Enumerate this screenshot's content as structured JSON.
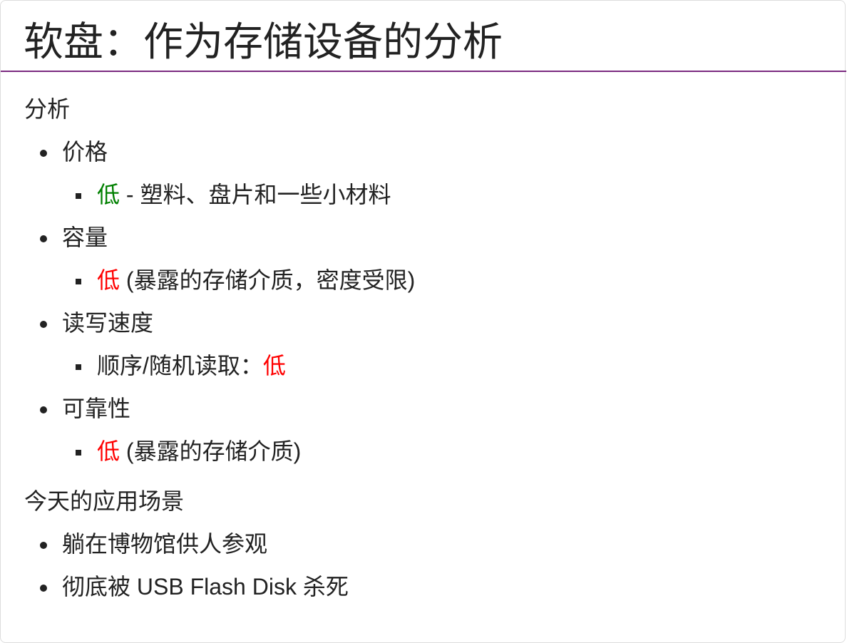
{
  "title": "软盘：作为存储设备的分析",
  "colors": {
    "rule": "#7b2a80",
    "green": "#008000",
    "red": "#ff0000"
  },
  "analysis": {
    "heading": "分析",
    "items": [
      {
        "label": "价格",
        "sub": {
          "prefix": "",
          "highlight": "低",
          "highlight_color": "green",
          "suffix": " - 塑料、盘片和一些小材料"
        }
      },
      {
        "label": "容量",
        "sub": {
          "prefix": "",
          "highlight": "低",
          "highlight_color": "red",
          "suffix": " (暴露的存储介质，密度受限)"
        }
      },
      {
        "label": "读写速度",
        "sub": {
          "prefix": "顺序/随机读取：",
          "highlight": "低",
          "highlight_color": "red",
          "suffix": ""
        }
      },
      {
        "label": "可靠性",
        "sub": {
          "prefix": "",
          "highlight": "低",
          "highlight_color": "red",
          "suffix": " (暴露的存储介质)"
        }
      }
    ]
  },
  "today": {
    "heading": "今天的应用场景",
    "items": [
      "躺在博物馆供人参观",
      "彻底被 USB Flash Disk 杀死"
    ]
  }
}
